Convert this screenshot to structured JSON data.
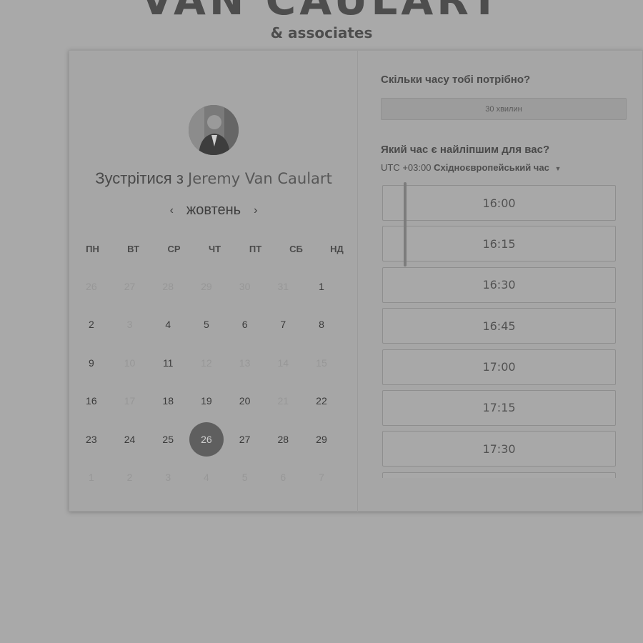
{
  "brand": {
    "title": "VAN CAULART",
    "subtitle": "& associates"
  },
  "host": {
    "prefix": "Зустрітися з",
    "name": "Jeremy Van Caulart"
  },
  "calendar": {
    "month": "жовтень",
    "weekdays": [
      "ПН",
      "ВТ",
      "СР",
      "ЧТ",
      "ПТ",
      "СБ",
      "НД"
    ],
    "days": [
      {
        "d": "26",
        "dim": true
      },
      {
        "d": "27",
        "dim": true
      },
      {
        "d": "28",
        "dim": true
      },
      {
        "d": "29",
        "dim": true
      },
      {
        "d": "30",
        "dim": true
      },
      {
        "d": "31",
        "dim": true
      },
      {
        "d": "1",
        "dim": false
      },
      {
        "d": "2",
        "dim": false
      },
      {
        "d": "3",
        "dim": true
      },
      {
        "d": "4",
        "dim": false
      },
      {
        "d": "5",
        "dim": false
      },
      {
        "d": "6",
        "dim": false
      },
      {
        "d": "7",
        "dim": false
      },
      {
        "d": "8",
        "dim": false
      },
      {
        "d": "9",
        "dim": false
      },
      {
        "d": "10",
        "dim": true
      },
      {
        "d": "11",
        "dim": false
      },
      {
        "d": "12",
        "dim": true
      },
      {
        "d": "13",
        "dim": true
      },
      {
        "d": "14",
        "dim": true
      },
      {
        "d": "15",
        "dim": true
      },
      {
        "d": "16",
        "dim": false
      },
      {
        "d": "17",
        "dim": true
      },
      {
        "d": "18",
        "dim": false
      },
      {
        "d": "19",
        "dim": false
      },
      {
        "d": "20",
        "dim": false
      },
      {
        "d": "21",
        "dim": true
      },
      {
        "d": "22",
        "dim": false
      },
      {
        "d": "23",
        "dim": false
      },
      {
        "d": "24",
        "dim": false
      },
      {
        "d": "25",
        "dim": false
      },
      {
        "d": "26",
        "dim": false,
        "selected": true
      },
      {
        "d": "27",
        "dim": false
      },
      {
        "d": "28",
        "dim": false
      },
      {
        "d": "29",
        "dim": false
      },
      {
        "d": "1",
        "dim": true
      },
      {
        "d": "2",
        "dim": true
      },
      {
        "d": "3",
        "dim": true
      },
      {
        "d": "4",
        "dim": true
      },
      {
        "d": "5",
        "dim": true
      },
      {
        "d": "6",
        "dim": true
      },
      {
        "d": "7",
        "dim": true
      }
    ]
  },
  "duration": {
    "question": "Скільки часу тобі потрібно?",
    "selected": "30 хвилин"
  },
  "timeslots": {
    "question": "Який час є найліпшим для вас?",
    "tz_offset": "UTC +03:00",
    "tz_name": "Східноєвропейський час",
    "slots": [
      "16:00",
      "16:15",
      "16:30",
      "16:45",
      "17:00",
      "17:15",
      "17:30",
      ""
    ]
  },
  "icons": {
    "prev": "chevron-left-icon",
    "next": "chevron-right-icon",
    "tz_dropdown": "caret-down-icon"
  },
  "colors": {
    "selected_day": "#5f5f5f",
    "page_bg": "#a9a9a9"
  }
}
